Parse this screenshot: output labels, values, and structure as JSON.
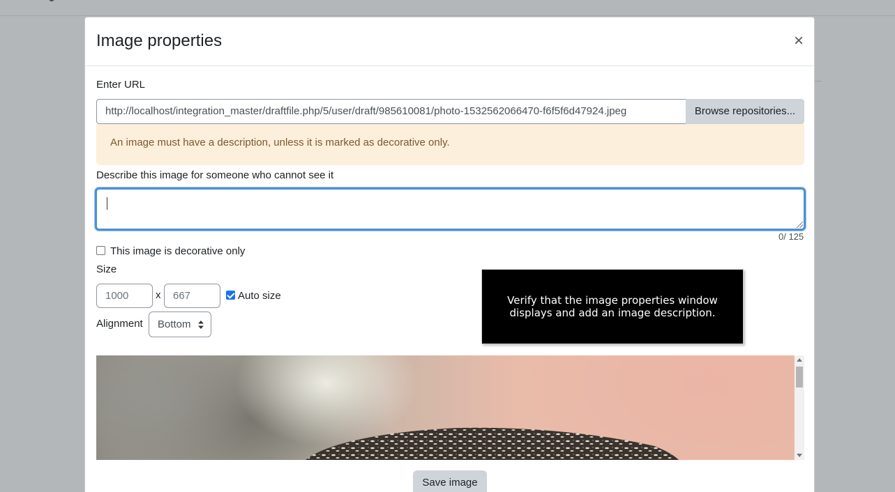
{
  "modal": {
    "title": "Image properties",
    "close_symbol": "×"
  },
  "url": {
    "label": "Enter URL",
    "value": "http://localhost/integration_master/draftfile.php/5/user/draft/985610081/photo-1532562066470-f6f5f6d47924.jpeg",
    "browse_label": "Browse repositories..."
  },
  "alert": {
    "text": "An image must have a description, unless it is marked as decorative only."
  },
  "description": {
    "label": "Describe this image for someone who cannot see it",
    "value": "",
    "counter": "0/ 125"
  },
  "decorative": {
    "label": "This image is decorative only",
    "checked": false
  },
  "size": {
    "label": "Size",
    "width_placeholder": "1000",
    "height_placeholder": "667",
    "separator": "x",
    "auto_size_label": "Auto size",
    "auto_size_checked": true
  },
  "alignment": {
    "label": "Alignment",
    "selected": "Bottom"
  },
  "preview": {
    "subject": "owl-photo"
  },
  "footer": {
    "save_label": "Save image"
  },
  "tooltip": {
    "text": "Verify that the image properties window displays and add an image description."
  },
  "colors": {
    "focus_border": "#4a90d9",
    "alert_bg": "#fcefdc",
    "alert_text": "#7d5a29",
    "button_bg": "#ced4da",
    "checkbox_checked": "#1a73e8",
    "backdrop": "#b3b7ba"
  }
}
